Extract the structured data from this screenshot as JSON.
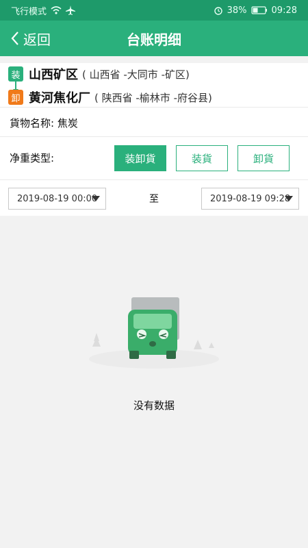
{
  "status_bar": {
    "carrier": "飞行模式",
    "battery": "38%",
    "time": "09:28"
  },
  "nav": {
    "back_label": "返回",
    "title": "台账明细"
  },
  "route": {
    "load_tag": "装",
    "load_place": "山西矿区",
    "load_detail": "( 山西省 -大同市 -矿区)",
    "unload_tag": "卸",
    "unload_place": "黄河焦化厂",
    "unload_detail": "( 陕西省 -榆林市 -府谷县)"
  },
  "goods": {
    "label": "貨物名称: 焦炭"
  },
  "weight_type": {
    "label": "净重类型:",
    "options": [
      "装卸貨",
      "装貨",
      "卸貨"
    ],
    "selected": "装卸貨"
  },
  "date_range": {
    "start": "2019-08-19 00:00",
    "separator": "至",
    "end": "2019-08-19 09:28"
  },
  "empty_state": {
    "text": "没有数据"
  },
  "colors": {
    "brand_green": "#2ab07c",
    "status_green": "#1e9a6a",
    "unload_orange": "#f07a1a"
  }
}
